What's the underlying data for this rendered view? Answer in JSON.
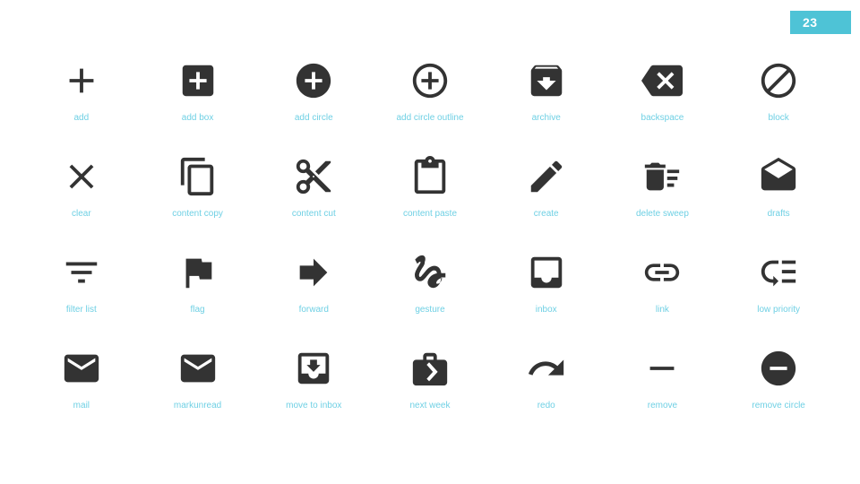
{
  "badge": {
    "value": "23",
    "background_color": "#4ec3d6",
    "text_color": "#ffffff"
  },
  "theme": {
    "background_color": "#ffffff",
    "icon_color": "#333333",
    "label_color": "#6fd0e4"
  },
  "grid": {
    "columns": 7,
    "rows": 4,
    "count": 28
  },
  "icons": [
    {
      "name": "add",
      "label": "add"
    },
    {
      "name": "add-box",
      "label": "add box"
    },
    {
      "name": "add-circle",
      "label": "add circle"
    },
    {
      "name": "add-circle-outline",
      "label": "add circle outline"
    },
    {
      "name": "archive",
      "label": "archive"
    },
    {
      "name": "backspace",
      "label": "backspace"
    },
    {
      "name": "block",
      "label": "block"
    },
    {
      "name": "clear",
      "label": "clear"
    },
    {
      "name": "content-copy",
      "label": "content copy"
    },
    {
      "name": "content-cut",
      "label": "content cut"
    },
    {
      "name": "content-paste",
      "label": "content paste"
    },
    {
      "name": "create",
      "label": "create"
    },
    {
      "name": "delete-sweep",
      "label": "delete sweep"
    },
    {
      "name": "drafts",
      "label": "drafts"
    },
    {
      "name": "filter-list",
      "label": "filter list"
    },
    {
      "name": "flag",
      "label": "flag"
    },
    {
      "name": "forward",
      "label": "forward"
    },
    {
      "name": "gesture",
      "label": "gesture"
    },
    {
      "name": "inbox",
      "label": "inbox"
    },
    {
      "name": "link",
      "label": "link"
    },
    {
      "name": "low-priority",
      "label": "low priority"
    },
    {
      "name": "mail",
      "label": "mail"
    },
    {
      "name": "markunread",
      "label": "markunread"
    },
    {
      "name": "move-to-inbox",
      "label": "move to inbox"
    },
    {
      "name": "next-week",
      "label": "next week"
    },
    {
      "name": "redo",
      "label": "redo"
    },
    {
      "name": "remove",
      "label": "remove"
    },
    {
      "name": "remove-circle",
      "label": "remove circle"
    }
  ]
}
